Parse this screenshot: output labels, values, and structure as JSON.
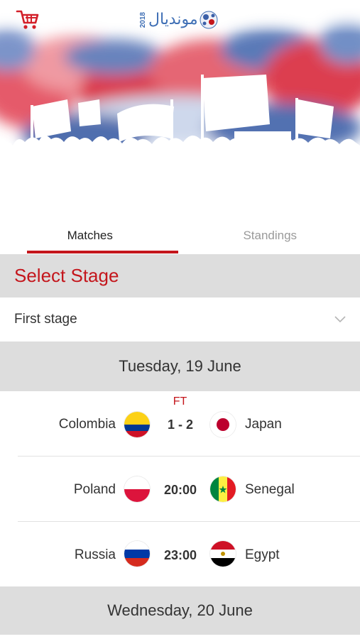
{
  "header": {
    "logo_text": "مونديال",
    "logo_year": "2018",
    "cart_icon": "cart-icon",
    "colors": {
      "red": "#e1222a",
      "blue": "#3a5fa8",
      "logo_blue": "#3f6fb5"
    }
  },
  "tabs": [
    {
      "label": "Matches",
      "active": true
    },
    {
      "label": "Standings",
      "active": false
    }
  ],
  "stage": {
    "title": "Select Stage",
    "selected": "First stage"
  },
  "days": [
    {
      "date": "Tuesday, 19 June",
      "matches": [
        {
          "status": "FT",
          "home": "Colombia",
          "home_flag": "colombia-flag-icon",
          "score": "1 - 2",
          "away": "Japan",
          "away_flag": "japan-flag-icon"
        },
        {
          "status": "",
          "home": "Poland",
          "home_flag": "poland-flag-icon",
          "score": "20:00",
          "away": "Senegal",
          "away_flag": "senegal-flag-icon"
        },
        {
          "status": "",
          "home": "Russia",
          "home_flag": "russia-flag-icon",
          "score": "23:00",
          "away": "Egypt",
          "away_flag": "egypt-flag-icon"
        }
      ]
    },
    {
      "date": "Wednesday, 20 June",
      "matches": []
    }
  ],
  "accent_color": "#c4161c"
}
